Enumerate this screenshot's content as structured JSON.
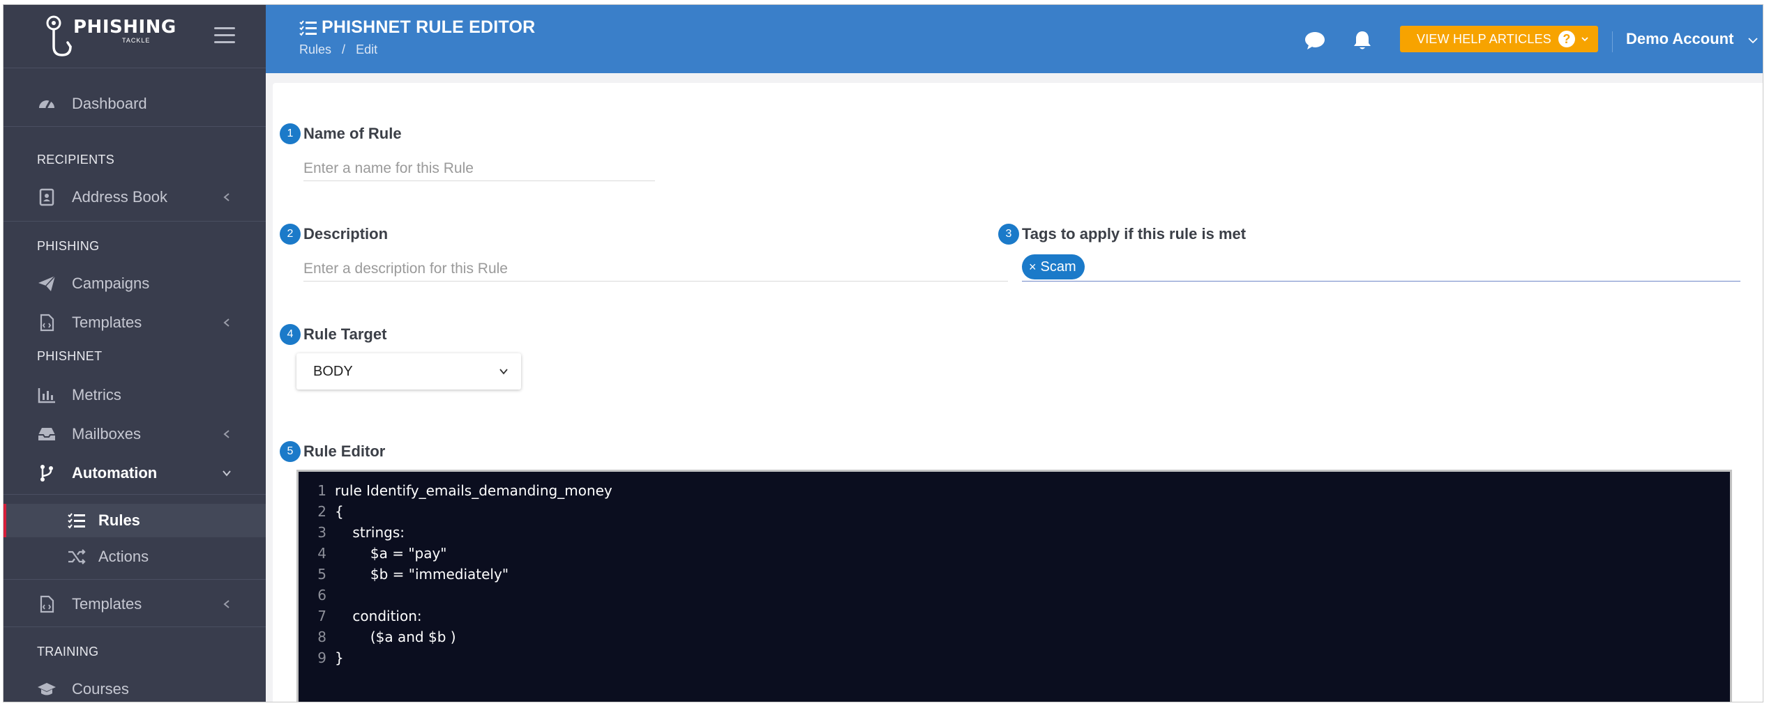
{
  "brand": {
    "name": "PHISHING",
    "sub": "TACKLE"
  },
  "sidebar": {
    "dashboard": "Dashboard",
    "sections": {
      "recipients": "RECIPIENTS",
      "phishing": "PHISHING",
      "phishnet": "PHISHNET",
      "training": "TRAINING"
    },
    "items": {
      "address_book": "Address Book",
      "campaigns": "Campaigns",
      "templates": "Templates",
      "metrics": "Metrics",
      "mailboxes": "Mailboxes",
      "automation": "Automation",
      "rules": "Rules",
      "actions": "Actions",
      "templates2": "Templates",
      "courses": "Courses"
    }
  },
  "header": {
    "title": "PHISHNET RULE EDITOR",
    "breadcrumb": [
      "Rules",
      "/",
      "Edit"
    ],
    "help_button": "VIEW HELP ARTICLES",
    "help_q": "?",
    "account": "Demo Account"
  },
  "form": {
    "name": {
      "step": "1",
      "label": "Name of Rule",
      "placeholder": "Enter a name for this Rule",
      "value": ""
    },
    "description": {
      "step": "2",
      "label": "Description",
      "placeholder": "Enter a description for this Rule",
      "value": ""
    },
    "tags": {
      "step": "3",
      "label": "Tags to apply if this rule is met",
      "remove": "×",
      "items": [
        "Scam"
      ]
    },
    "target": {
      "step": "4",
      "label": "Rule Target",
      "value": "BODY"
    },
    "editor": {
      "step": "5",
      "label": "Rule Editor",
      "lines": [
        {
          "n": "1",
          "text": "rule Identify_emails_demanding_money"
        },
        {
          "n": "2",
          "text": "{"
        },
        {
          "n": "3",
          "text": "    strings:"
        },
        {
          "n": "4",
          "text": "        $a = \"pay\""
        },
        {
          "n": "5",
          "text": "        $b = \"immediately\""
        },
        {
          "n": "6",
          "text": ""
        },
        {
          "n": "7",
          "text": "    condition:"
        },
        {
          "n": "8",
          "text": "        ($a and $b )"
        },
        {
          "n": "9",
          "text": "}"
        }
      ]
    }
  },
  "colors": {
    "header": "#3a7fc9",
    "sidebar": "#393d4d",
    "accent": "#1b7ac9",
    "help": "#f7a300",
    "active_marker": "#d61f3a",
    "editor_bg": "#0b0e1f"
  }
}
